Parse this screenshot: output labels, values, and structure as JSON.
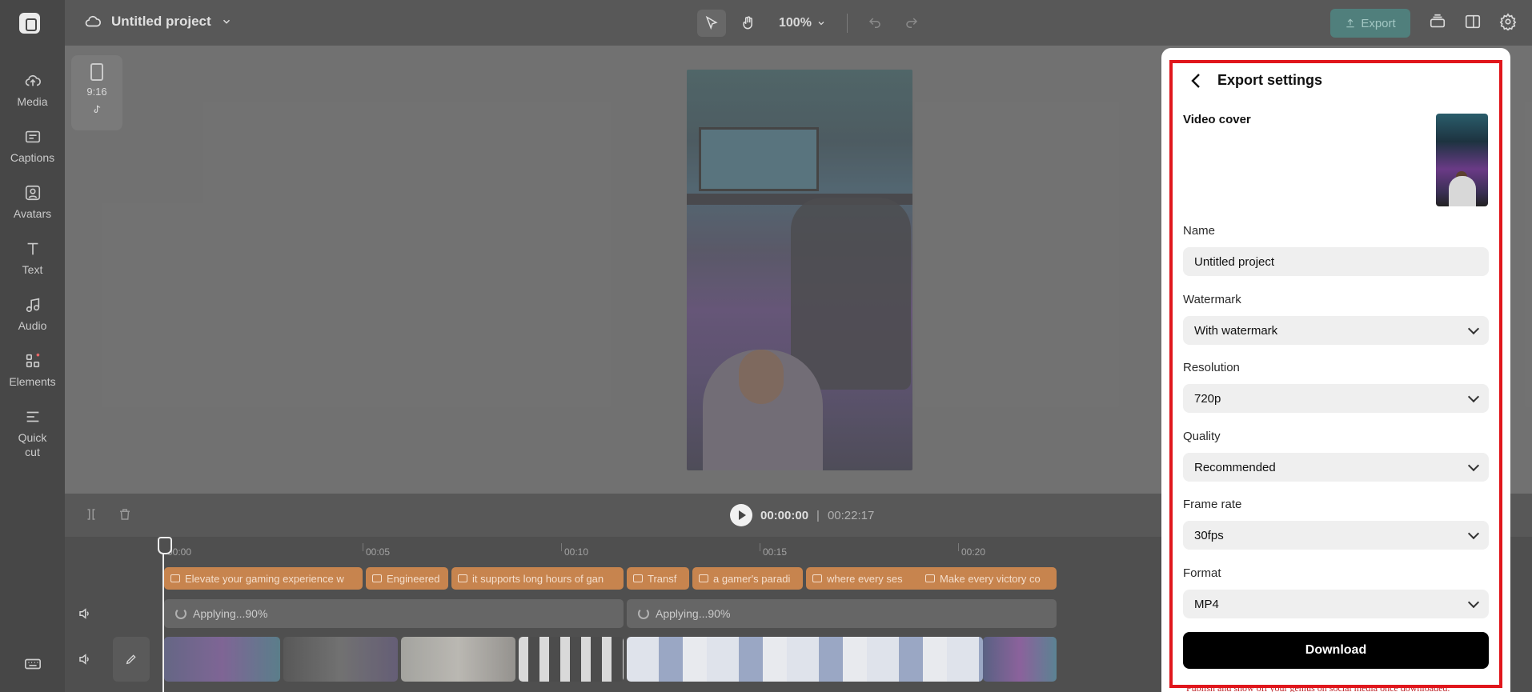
{
  "sidebar": {
    "logo_icon": "capcut-logo-icon",
    "items": [
      {
        "label": "Media",
        "icon": "cloud-upload-icon"
      },
      {
        "label": "Captions",
        "icon": "captions-icon"
      },
      {
        "label": "Avatars",
        "icon": "avatar-icon"
      },
      {
        "label": "Text",
        "icon": "text-icon"
      },
      {
        "label": "Audio",
        "icon": "music-note-icon"
      },
      {
        "label": "Elements",
        "icon": "elements-icon"
      },
      {
        "label": "Quick",
        "label2": "cut",
        "icon": "quick-cut-icon"
      }
    ]
  },
  "topbar": {
    "project_name": "Untitled project",
    "zoom": "100%",
    "export_label": "Export"
  },
  "canvas": {
    "aspect_ratio": "9:16"
  },
  "playback": {
    "current_time": "00:00:00",
    "separator": "|",
    "total_time": "00:22:17"
  },
  "timeline": {
    "ruler": [
      "00:00",
      "00:05",
      "00:10",
      "00:15",
      "00:20"
    ],
    "captions": [
      "Elevate your gaming experience w",
      "Engineered",
      "it supports long hours of gan",
      "Transf",
      "a gamer's paradi",
      "where every ses",
      "Make every victory co"
    ],
    "audio": [
      "Applying...90%",
      "Applying...90%"
    ]
  },
  "export_panel": {
    "title": "Export settings",
    "video_cover_label": "Video cover",
    "name_label": "Name",
    "name_value": "Untitled project",
    "watermark_label": "Watermark",
    "watermark_value": "With watermark",
    "resolution_label": "Resolution",
    "resolution_value": "720p",
    "quality_label": "Quality",
    "quality_value": "Recommended",
    "framerate_label": "Frame rate",
    "framerate_value": "30fps",
    "format_label": "Format",
    "format_value": "MP4",
    "download_label": "Download",
    "note": "Publish and show off your genius on social media once downloaded.",
    "highlight_color": "#e0161c"
  }
}
